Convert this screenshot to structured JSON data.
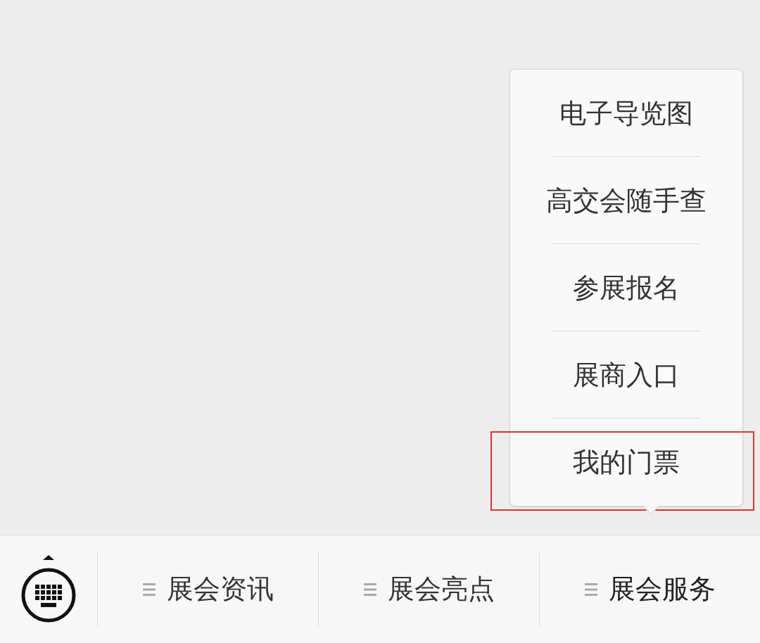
{
  "menu": {
    "items": [
      {
        "label": "电子导览图",
        "highlighted": false
      },
      {
        "label": "高交会随手查",
        "highlighted": false
      },
      {
        "label": "参展报名",
        "highlighted": false
      },
      {
        "label": "展商入口",
        "highlighted": false
      },
      {
        "label": "我的门票",
        "highlighted": true
      }
    ]
  },
  "bottom_bar": {
    "tabs": [
      {
        "label": "展会资讯",
        "expanded": false
      },
      {
        "label": "展会亮点",
        "expanded": false
      },
      {
        "label": "展会服务",
        "expanded": true
      }
    ]
  }
}
